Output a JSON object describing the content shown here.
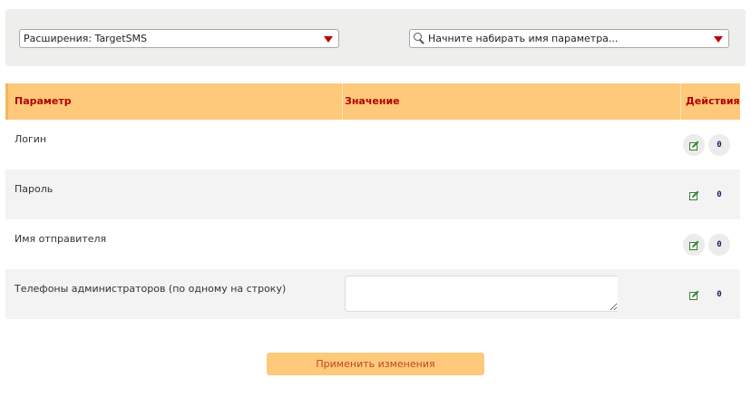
{
  "filters": {
    "extension_select": {
      "value": "Расширения: TargetSMS"
    },
    "parameter_search": {
      "placeholder": "Начните набирать имя параметра..."
    }
  },
  "table": {
    "headers": {
      "param": "Параметр",
      "value": "Значение",
      "actions": "Действия"
    },
    "rows": [
      {
        "name": "Логин",
        "value": "",
        "reset_label": "0"
      },
      {
        "name": "Пароль",
        "value": "",
        "reset_label": "0"
      },
      {
        "name": "Имя отправителя",
        "value": "",
        "reset_label": "0"
      },
      {
        "name": "Телефоны администраторов (по одному на строку)",
        "value": "",
        "reset_label": "0"
      }
    ]
  },
  "apply_button": {
    "label": "Применить изменения"
  },
  "colors": {
    "header_bg": "#fec97b",
    "header_text": "#b30000",
    "caret": "#c00000",
    "apply_text": "#c0471a",
    "alt_row_bg": "#f3f3f3"
  },
  "icons": {
    "edit": "edit-icon",
    "search": "search-icon",
    "dropdown": "chevron-down-icon"
  }
}
